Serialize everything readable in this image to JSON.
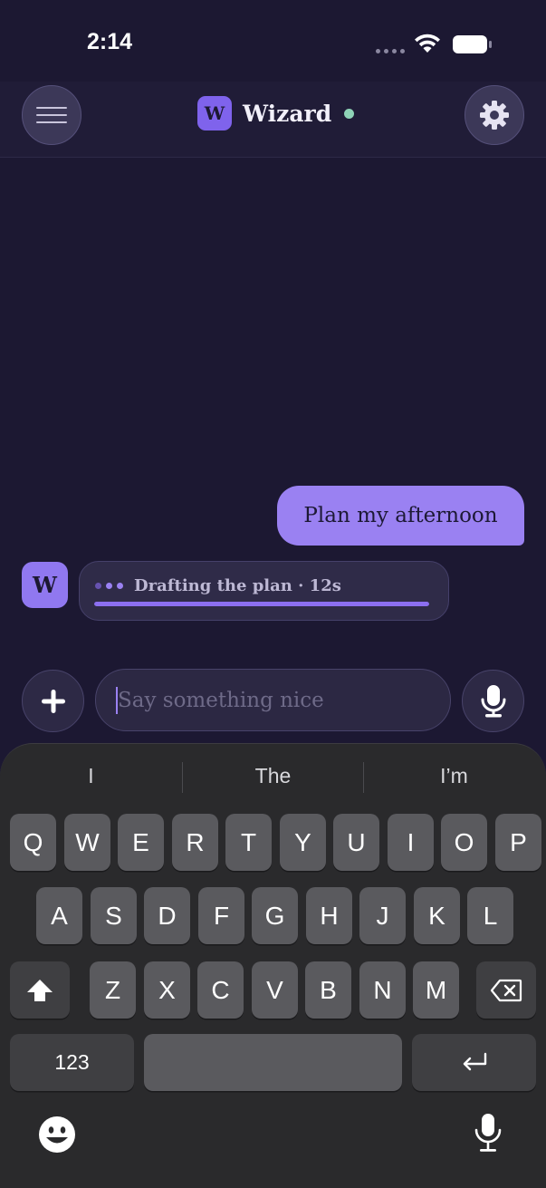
{
  "status_bar": {
    "time": "2:14"
  },
  "header": {
    "brand_initial": "W",
    "title": "Wizard",
    "status_color": "#8fd3b7"
  },
  "icons": {
    "menu": "hamburger-icon",
    "settings": "gear-icon",
    "add": "plus-icon",
    "mic": "microphone-icon",
    "shift": "shift-icon",
    "backspace": "backspace-icon",
    "return": "return-icon",
    "emoji": "emoji-icon",
    "dictation": "dictation-icon"
  },
  "messages": [
    {
      "role": "user",
      "text": "Plan my afternoon"
    },
    {
      "role": "assistant",
      "avatar": "W",
      "status_text": "Drafting the plan · 12s",
      "progress_percent": 100
    }
  ],
  "composer": {
    "placeholder": "Say something nice",
    "value": ""
  },
  "keyboard": {
    "suggestions": [
      "I",
      "The",
      "I’m"
    ],
    "row1": [
      "Q",
      "W",
      "E",
      "R",
      "T",
      "Y",
      "U",
      "I",
      "O",
      "P"
    ],
    "row2": [
      "A",
      "S",
      "D",
      "F",
      "G",
      "H",
      "J",
      "K",
      "L"
    ],
    "row3": [
      "Z",
      "X",
      "C",
      "V",
      "B",
      "N",
      "M"
    ],
    "numbers_label": "123"
  },
  "colors": {
    "background": "#1c1832",
    "accent": "#9a81f2",
    "accent_dark": "#7f63ec",
    "keyboard_bg": "#2a2a2c"
  }
}
